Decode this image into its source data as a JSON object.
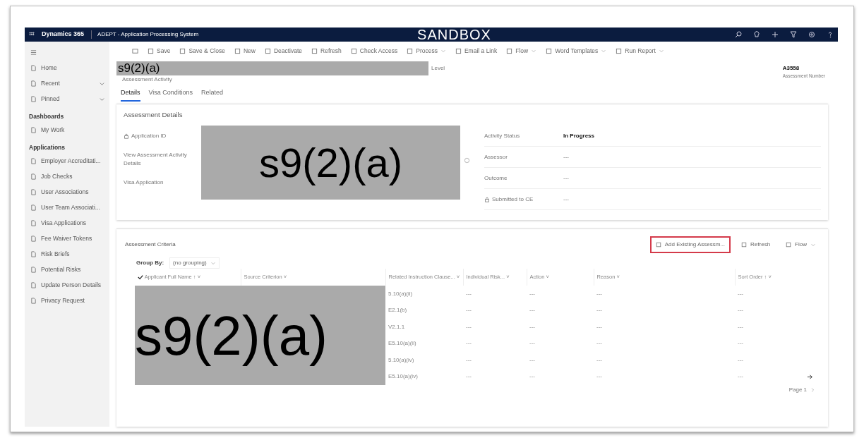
{
  "app_bar": {
    "brand": "Dynamics 365",
    "app_name": "ADEPT - Application Processing System",
    "environment": "SANDBOX"
  },
  "command_bar": [
    {
      "label": "Save",
      "has_menu": false
    },
    {
      "label": "Save & Close",
      "has_menu": false
    },
    {
      "label": "New",
      "has_menu": false
    },
    {
      "label": "Deactivate",
      "has_menu": false
    },
    {
      "label": "Refresh",
      "has_menu": false
    },
    {
      "label": "Check Access",
      "has_menu": false
    },
    {
      "label": "Process",
      "has_menu": true
    },
    {
      "label": "Email a Link",
      "has_menu": false
    },
    {
      "label": "Flow",
      "has_menu": true
    },
    {
      "label": "Word Templates",
      "has_menu": true
    },
    {
      "label": "Run Report",
      "has_menu": true
    }
  ],
  "sidebar": {
    "top_items": [
      {
        "label": "Home",
        "expandable": false
      },
      {
        "label": "Recent",
        "expandable": true
      },
      {
        "label": "Pinned",
        "expandable": true
      }
    ],
    "sections": [
      {
        "title": "Dashboards",
        "items": [
          "My Work"
        ]
      },
      {
        "title": "Applications",
        "items": [
          "Employer Accreditati...",
          "Job Checks",
          "User Associations",
          "User Team Associati...",
          "Visa Applications",
          "Fee Waiver Tokens",
          "Risk Briefs",
          "Potential Risks",
          "Update Person Details",
          "Privacy Request"
        ]
      }
    ]
  },
  "record": {
    "title_redaction": "s9(2)(a)",
    "subtitle": "Assessment Activity",
    "level_label": "Level",
    "number": "A3558",
    "number_label": "Assessment Number"
  },
  "tabs": [
    {
      "label": "Details",
      "selected": true
    },
    {
      "label": "Visa Conditions",
      "selected": false
    },
    {
      "label": "Related",
      "selected": false
    }
  ],
  "details": {
    "title": "Assessment Details",
    "redaction": "s9(2)(a)",
    "left_fields": [
      {
        "label": "Application ID",
        "locked": true
      },
      {
        "label": "View Assessment Activity Details",
        "locked": false
      },
      {
        "label": "Visa Application",
        "locked": false
      }
    ],
    "right_fields": [
      {
        "label": "Activity Status",
        "value": "In Progress",
        "locked": false
      },
      {
        "label": "Assessor",
        "value": "---",
        "locked": false
      },
      {
        "label": "Outcome",
        "value": "---",
        "locked": false
      },
      {
        "label": "Submitted to CE",
        "value": "---",
        "locked": true
      }
    ]
  },
  "criteria": {
    "title": "Assessment Criteria",
    "buttons": [
      {
        "label": "Add Existing Assessm...",
        "highlighted": true,
        "has_menu": false
      },
      {
        "label": "Refresh",
        "highlighted": false,
        "has_menu": false
      },
      {
        "label": "Flow",
        "highlighted": false,
        "has_menu": true
      }
    ],
    "group_by_label": "Group By:",
    "group_by_value": "(no grouping)",
    "columns": [
      "Applicant Full Name ↑ ˅",
      "Source Criterion ˅",
      "Related Instruction Clause... ˅",
      "Individual Risk... ˅",
      "Action ˅",
      "Reason ˅",
      "Sort Order ↑ ˅"
    ],
    "redaction": "s9(2)(a)",
    "rows": [
      [
        "",
        "",
        "5.10(a)(ii)",
        "---",
        "---",
        "---",
        "---"
      ],
      [
        "",
        "",
        "E2.1(b)",
        "---",
        "---",
        "---",
        "---"
      ],
      [
        "",
        "",
        "V2.1.1",
        "---",
        "---",
        "---",
        "---"
      ],
      [
        "",
        "",
        "E5.10(a)(ii)",
        "---",
        "---",
        "---",
        "---"
      ],
      [
        "",
        "",
        "5.10(a)(iv)",
        "---",
        "---",
        "---",
        "---"
      ],
      [
        "",
        "",
        "E5.10(a)(iv)",
        "---",
        "---",
        "---",
        "---"
      ]
    ],
    "paging": "Page 1"
  }
}
